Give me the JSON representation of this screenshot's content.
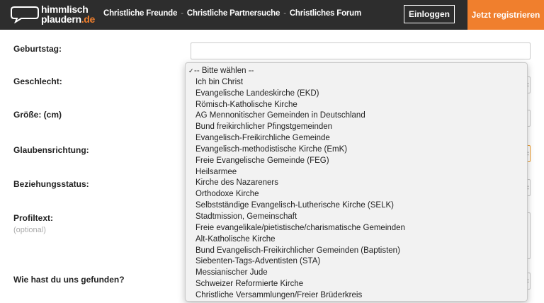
{
  "header": {
    "logo_line1": "himmlisch",
    "logo_line2": "plaudern",
    "logo_tld": ".de",
    "nav": [
      "Christliche Freunde",
      "Christliche Partnersuche",
      "Christliches Forum"
    ],
    "nav_separator": "-",
    "login_label": "Einloggen",
    "register_label": "Jetzt registrieren",
    "accent_color": "#f07f2d"
  },
  "form": {
    "birthday_label": "Geburtstag:",
    "gender_label": "Geschlecht:",
    "height_label": "Größe: (cm)",
    "faith_label": "Glaubensrichtung:",
    "relationship_label": "Beziehungsstatus:",
    "profile_label": "Profiltext:",
    "profile_optional": "(optional)",
    "found_label": "Wie hast du uns gefunden?"
  },
  "dropdown": {
    "check": "✓",
    "options": [
      "-- Bitte wählen --",
      "Ich bin Christ",
      "Evangelische Landeskirche (EKD)",
      "Römisch-Katholische Kirche",
      "AG Mennonitischer Gemeinden in Deutschland",
      "Bund freikirchlicher Pfingstgemeinden",
      "Evangelisch-Freikirchliche Gemeinde",
      "Evangelisch-methodistische Kirche (EmK)",
      "Freie Evangelische Gemeinde (FEG)",
      "Heilsarmee",
      "Kirche des Nazareners",
      "Orthodoxe Kirche",
      "Selbstständige Evangelisch-Lutherische Kirche (SELK)",
      "Stadtmission, Gemeinschaft",
      "Freie evangelikale/pietistische/charismatische Gemeinden",
      "Alt-Katholische Kirche",
      "Bund Evangelisch-Freikirchlicher Gemeinden (Baptisten)",
      "Siebenten-Tags-Adventisten (STA)",
      "Messianischer Jude",
      "Schweizer Reformierte Kirche",
      "Christliche Versammlungen/Freier Brüderkreis"
    ]
  }
}
